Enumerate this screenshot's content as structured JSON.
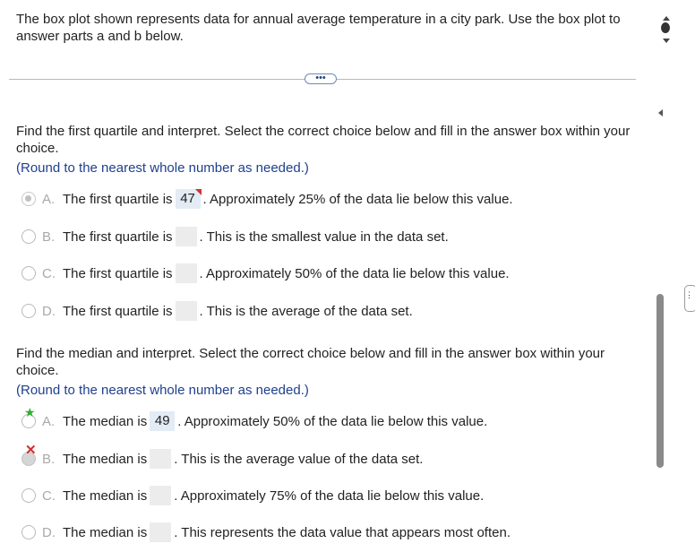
{
  "intro": "The box plot shown represents data for annual average temperature in a city park. Use the box plot to answer parts a and b below.",
  "more_button": "•••",
  "part_a": {
    "question": "Find the first quartile and interpret. Select the correct choice below and fill in the answer box within your choice.",
    "round_note": "(Round to the nearest whole number as needed.)",
    "options": [
      {
        "letter": "A.",
        "prefix": "The first quartile is",
        "value": "47",
        "suffix": ". Approximately 25% of the data lie below this value."
      },
      {
        "letter": "B.",
        "prefix": "The first quartile is",
        "value": "",
        "suffix": ". This is the smallest value in the data set."
      },
      {
        "letter": "C.",
        "prefix": "The first quartile is",
        "value": "",
        "suffix": ". Approximately 50% of the data lie below this value."
      },
      {
        "letter": "D.",
        "prefix": "The first quartile is",
        "value": "",
        "suffix": ". This is the average of the data set."
      }
    ]
  },
  "part_b": {
    "question": "Find the median and interpret. Select the correct choice below and fill in the answer box within your choice.",
    "round_note": "(Round to the nearest whole number as needed.)",
    "options": [
      {
        "letter": "A.",
        "prefix": "The median is",
        "value": "49",
        "suffix": ". Approximately 50% of the data lie below this value."
      },
      {
        "letter": "B.",
        "prefix": "The median is",
        "value": "",
        "suffix": ". This is the average value of the data set."
      },
      {
        "letter": "C.",
        "prefix": "The median is",
        "value": "",
        "suffix": ". Approximately 75% of the data lie below this value."
      },
      {
        "letter": "D.",
        "prefix": "The median is",
        "value": "",
        "suffix": ". This represents the data value that appears most often."
      }
    ]
  },
  "colors": {
    "note_blue": "#1f3f8f",
    "correct_star": "#2fae2f",
    "wrong_x": "#d0302f"
  },
  "icons": {
    "correct": "star-icon",
    "incorrect": "x-icon"
  },
  "side_handle": "⋮⋮"
}
